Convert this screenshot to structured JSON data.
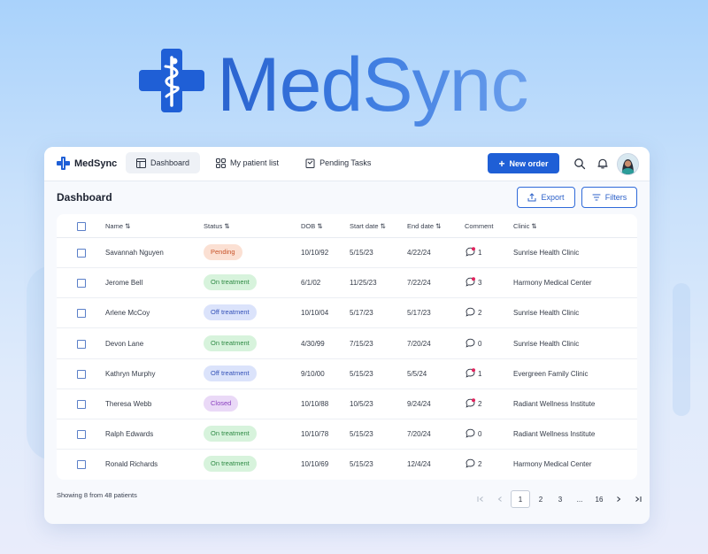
{
  "hero": {
    "brand_name": "MedSync"
  },
  "app": {
    "brand_name": "MedSync",
    "nav": [
      {
        "label": "Dashboard",
        "icon": "table-icon",
        "active": true
      },
      {
        "label": "My patient list",
        "icon": "grid-icon",
        "active": false
      },
      {
        "label": "Pending Tasks",
        "icon": "clipboard-icon",
        "active": false
      }
    ],
    "new_order_label": "New order",
    "page_title": "Dashboard",
    "export_label": "Export",
    "filters_label": "Filters"
  },
  "table": {
    "columns": {
      "name": "Name ⇅",
      "status": "Status ⇅",
      "dob": "DOB ⇅",
      "start": "Start date ⇅",
      "end": "End date ⇅",
      "comment": "Comment",
      "clinic": "Clinic ⇅"
    },
    "rows": [
      {
        "name": "Savannah Nguyen",
        "status": "Pending",
        "kind": "pending",
        "dob": "10/10/92",
        "start": "5/15/23",
        "end": "4/22/24",
        "comments": "1",
        "unread": true,
        "clinic": "Sunrise Health Clinic"
      },
      {
        "name": "Jerome Bell",
        "status": "On treatment",
        "kind": "on",
        "dob": "6/1/02",
        "start": "11/25/23",
        "end": "7/22/24",
        "comments": "3",
        "unread": true,
        "clinic": "Harmony Medical Center"
      },
      {
        "name": "Arlene McCoy",
        "status": "Off treatment",
        "kind": "off",
        "dob": "10/10/04",
        "start": "5/17/23",
        "end": "5/17/23",
        "comments": "2",
        "unread": false,
        "clinic": "Sunrise Health Clinic"
      },
      {
        "name": "Devon Lane",
        "status": "On treatment",
        "kind": "on",
        "dob": "4/30/99",
        "start": "7/15/23",
        "end": "7/20/24",
        "comments": "0",
        "unread": false,
        "clinic": "Sunrise Health Clinic"
      },
      {
        "name": "Kathryn Murphy",
        "status": "Off treatment",
        "kind": "off",
        "dob": "9/10/00",
        "start": "5/15/23",
        "end": "5/5/24",
        "comments": "1",
        "unread": true,
        "clinic": "Evergreen Family Clinic"
      },
      {
        "name": "Theresa Webb",
        "status": "Closed",
        "kind": "closed",
        "dob": "10/10/88",
        "start": "10/5/23",
        "end": "9/24/24",
        "comments": "2",
        "unread": true,
        "clinic": "Radiant Wellness Institute"
      },
      {
        "name": "Ralph Edwards",
        "status": "On treatment",
        "kind": "on",
        "dob": "10/10/78",
        "start": "5/15/23",
        "end": "7/20/24",
        "comments": "0",
        "unread": false,
        "clinic": "Radiant Wellness Institute"
      },
      {
        "name": "Ronald Richards",
        "status": "On treatment",
        "kind": "on",
        "dob": "10/10/69",
        "start": "5/15/23",
        "end": "12/4/24",
        "comments": "2",
        "unread": false,
        "clinic": "Harmony Medical Center"
      }
    ]
  },
  "footer": {
    "summary": "Showing 8 from 48 patients",
    "pages": [
      "1",
      "2",
      "3",
      "...",
      "16"
    ],
    "current_page": "1"
  },
  "colors": {
    "primary": "#1f5fd6",
    "pending": "#c8542a",
    "on_treatment": "#2f8a45",
    "off_treatment": "#3552b8",
    "closed": "#8a3fbf",
    "unread_dot": "#e0245e"
  }
}
